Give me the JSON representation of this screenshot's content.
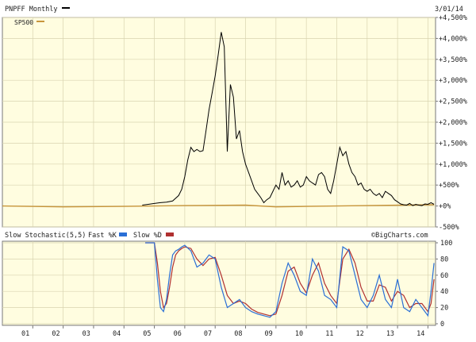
{
  "chart_data": [
    {
      "type": "line",
      "title": "PNPFF Monthly",
      "date": "3/01/14",
      "y_ticks": [
        "+4,500%",
        "+4,000%",
        "+3,500%",
        "+3,000%",
        "+2,500%",
        "+2,000%",
        "+1,500%",
        "+1,000%",
        "+500%",
        "+0%",
        "-500%"
      ],
      "ylim": [
        -500,
        4500
      ],
      "xlim": [
        2000.0,
        2014.25
      ],
      "grid": true,
      "series": [
        {
          "name": "PNPFF",
          "color": "#000000",
          "x": [
            2004.6,
            2004.8,
            2005.0,
            2005.2,
            2005.4,
            2005.6,
            2005.8,
            2005.9,
            2006.0,
            2006.1,
            2006.2,
            2006.3,
            2006.4,
            2006.5,
            2006.6,
            2006.7,
            2006.8,
            2006.9,
            2007.0,
            2007.1,
            2007.2,
            2007.3,
            2007.4,
            2007.5,
            2007.6,
            2007.7,
            2007.8,
            2007.9,
            2008.0,
            2008.1,
            2008.2,
            2008.3,
            2008.4,
            2008.5,
            2008.6,
            2008.7,
            2008.8,
            2008.9,
            2009.0,
            2009.1,
            2009.2,
            2009.3,
            2009.4,
            2009.5,
            2009.6,
            2009.7,
            2009.8,
            2009.9,
            2010.0,
            2010.1,
            2010.2,
            2010.3,
            2010.4,
            2010.5,
            2010.6,
            2010.7,
            2010.8,
            2010.9,
            2011.0,
            2011.1,
            2011.2,
            2011.3,
            2011.4,
            2011.5,
            2011.6,
            2011.7,
            2011.8,
            2011.9,
            2012.0,
            2012.1,
            2012.2,
            2012.3,
            2012.4,
            2012.5,
            2012.6,
            2012.7,
            2012.8,
            2012.9,
            2013.0,
            2013.1,
            2013.2,
            2013.3,
            2013.4,
            2013.5,
            2013.6,
            2013.7,
            2013.8,
            2013.9,
            2014.0,
            2014.1,
            2014.2
          ],
          "y": [
            20,
            40,
            60,
            80,
            90,
            120,
            250,
            400,
            700,
            1100,
            1400,
            1300,
            1350,
            1300,
            1320,
            1800,
            2300,
            2700,
            3100,
            3600,
            4150,
            3800,
            1300,
            2900,
            2600,
            1600,
            1800,
            1300,
            1000,
            800,
            600,
            400,
            300,
            200,
            80,
            150,
            200,
            350,
            500,
            400,
            800,
            500,
            600,
            450,
            500,
            600,
            450,
            500,
            700,
            600,
            550,
            500,
            750,
            800,
            700,
            400,
            300,
            600,
            1000,
            1400,
            1200,
            1300,
            1000,
            800,
            700,
            500,
            550,
            400,
            350,
            400,
            300,
            250,
            300,
            200,
            350,
            300,
            250,
            150,
            100,
            50,
            30,
            20,
            60,
            10,
            40,
            20,
            10,
            50,
            40,
            80,
            40
          ]
        },
        {
          "name": "SP500",
          "color": "#c8963c",
          "x": [
            2000.0,
            2002.0,
            2004.0,
            2006.0,
            2008.0,
            2009.0,
            2010.0,
            2012.0,
            2014.2
          ],
          "y": [
            0,
            -20,
            -10,
            10,
            20,
            -20,
            -10,
            10,
            30
          ]
        }
      ]
    },
    {
      "type": "line",
      "title": "Slow Stochastic(5,5)",
      "legend": [
        "Fast %K",
        "Slow %D"
      ],
      "credit": "©BigCharts.com",
      "y_ticks": [
        "100",
        "80",
        "60",
        "40",
        "20",
        "0"
      ],
      "ylim": [
        0,
        100
      ],
      "x_ticks": [
        "01",
        "02",
        "03",
        "04",
        "05",
        "06",
        "07",
        "08",
        "09",
        "10",
        "11",
        "12",
        "13",
        "14"
      ],
      "grid": true,
      "series": [
        {
          "name": "Fast %K",
          "color": "#2a6fd6",
          "x": [
            2004.7,
            2004.9,
            2005.0,
            2005.1,
            2005.2,
            2005.3,
            2005.4,
            2005.5,
            2005.6,
            2005.7,
            2005.8,
            2005.9,
            2006.0,
            2006.2,
            2006.4,
            2006.6,
            2006.8,
            2007.0,
            2007.2,
            2007.4,
            2007.6,
            2007.8,
            2008.0,
            2008.2,
            2008.4,
            2008.6,
            2008.8,
            2009.0,
            2009.2,
            2009.4,
            2009.6,
            2009.8,
            2010.0,
            2010.2,
            2010.4,
            2010.6,
            2010.8,
            2011.0,
            2011.2,
            2011.4,
            2011.6,
            2011.8,
            2012.0,
            2012.2,
            2012.4,
            2012.6,
            2012.8,
            2013.0,
            2013.2,
            2013.4,
            2013.6,
            2013.8,
            2014.0,
            2014.1,
            2014.2
          ],
          "y": [
            100,
            100,
            100,
            55,
            20,
            15,
            30,
            60,
            85,
            90,
            92,
            95,
            97,
            90,
            70,
            75,
            85,
            80,
            45,
            20,
            25,
            30,
            20,
            15,
            12,
            10,
            8,
            15,
            50,
            75,
            60,
            40,
            35,
            80,
            65,
            35,
            30,
            20,
            95,
            90,
            60,
            30,
            20,
            35,
            60,
            30,
            20,
            55,
            20,
            15,
            30,
            20,
            10,
            40,
            75
          ]
        },
        {
          "name": "Slow %D",
          "color": "#b03030",
          "x": [
            2004.7,
            2004.9,
            2005.0,
            2005.1,
            2005.2,
            2005.3,
            2005.4,
            2005.5,
            2005.6,
            2005.7,
            2005.8,
            2005.9,
            2006.0,
            2006.2,
            2006.4,
            2006.6,
            2006.8,
            2007.0,
            2007.2,
            2007.4,
            2007.6,
            2007.8,
            2008.0,
            2008.2,
            2008.4,
            2008.6,
            2008.8,
            2009.0,
            2009.2,
            2009.4,
            2009.6,
            2009.8,
            2010.0,
            2010.2,
            2010.4,
            2010.6,
            2010.8,
            2011.0,
            2011.2,
            2011.4,
            2011.6,
            2011.8,
            2012.0,
            2012.2,
            2012.4,
            2012.6,
            2012.8,
            2013.0,
            2013.2,
            2013.4,
            2013.6,
            2013.8,
            2014.0,
            2014.1,
            2014.2
          ],
          "y": [
            100,
            100,
            100,
            75,
            40,
            20,
            25,
            45,
            70,
            85,
            90,
            93,
            95,
            93,
            80,
            72,
            80,
            82,
            60,
            35,
            25,
            28,
            25,
            18,
            14,
            12,
            10,
            12,
            35,
            65,
            70,
            50,
            38,
            60,
            75,
            50,
            35,
            25,
            80,
            92,
            75,
            45,
            28,
            28,
            48,
            45,
            28,
            40,
            35,
            20,
            25,
            25,
            15,
            25,
            55
          ]
        }
      ]
    }
  ]
}
